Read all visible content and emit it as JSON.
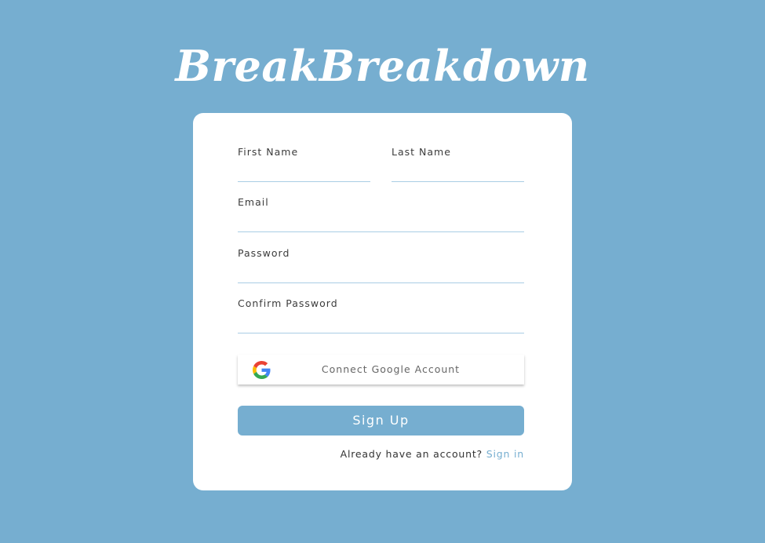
{
  "app": {
    "title": "BreakBreakdown"
  },
  "form": {
    "first_name": {
      "label": "First Name",
      "value": ""
    },
    "last_name": {
      "label": "Last Name",
      "value": ""
    },
    "email": {
      "label": "Email",
      "value": ""
    },
    "password": {
      "label": "Password",
      "value": ""
    },
    "confirm_password": {
      "label": "Confirm Password",
      "value": ""
    },
    "google_button": {
      "label": "Connect Google Account",
      "icon": "google-icon"
    },
    "signup_button": {
      "label": "Sign Up"
    },
    "signin_prompt": {
      "text": "Already have an account?",
      "link": "Sign in"
    }
  },
  "colors": {
    "background": "#76aed0",
    "card": "#ffffff",
    "accent": "#76aed0",
    "underline": "#a9cde4"
  }
}
